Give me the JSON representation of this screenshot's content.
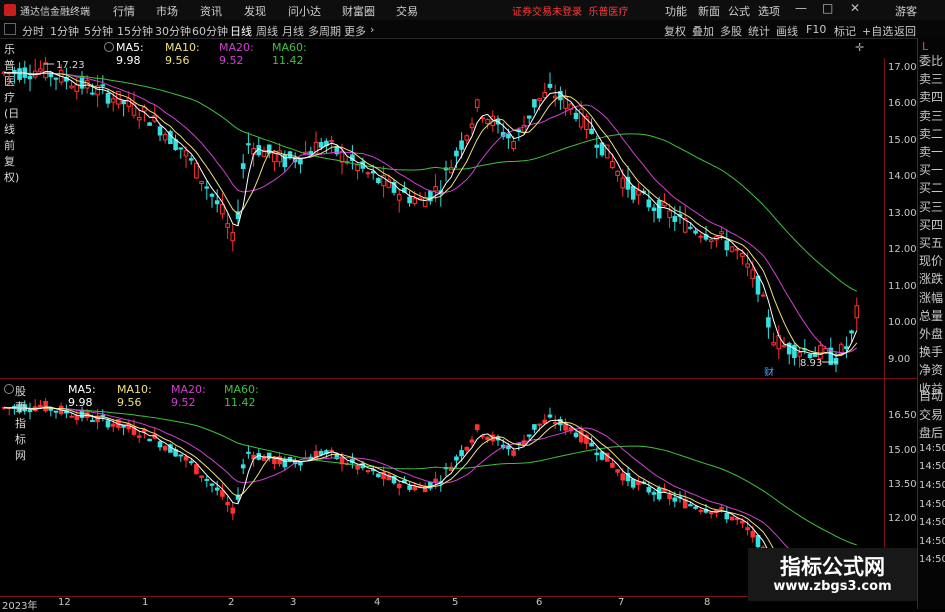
{
  "colors": {
    "up": "#ff3030",
    "down": "#35e0e0",
    "ma5": "#ffffff",
    "ma10": "#f0e080",
    "ma20": "#d040d0",
    "ma60": "#40c040",
    "accent": "#ff3b3b"
  },
  "titlebar": {
    "app_name": "通达信金融终端",
    "menu": [
      "行情",
      "市场",
      "资讯",
      "发现",
      "问小达",
      "财富圈",
      "交易"
    ],
    "status_text": "证券交易未登录",
    "stock_name": "乐普医疗",
    "right_menu": [
      "功能",
      "新面",
      "公式",
      "选项"
    ],
    "guest": "游客",
    "window_controls": [
      "—",
      "□",
      "✕"
    ]
  },
  "periods": [
    "分时",
    "1分钟",
    "5分钟",
    "15分钟",
    "30分钟",
    "60分钟",
    "日线",
    "周线",
    "月线",
    "多周期",
    "更多"
  ],
  "period_active": "日线",
  "toolbar": [
    "复权",
    "叠加",
    "多股",
    "统计",
    "画线",
    "F10",
    "标记",
    "+自选",
    "返回"
  ],
  "upper": {
    "title": "乐普医疗(日线 前复权)",
    "ma5": "MA5: 9.98",
    "ma10": "MA10: 9.56",
    "ma20": "MA20: 9.52",
    "ma60": "MA60: 11.42",
    "high_label": "17.23",
    "low_label": "8.93",
    "cai_label": "财",
    "price_labels": [
      "17.00",
      "16.00",
      "15.00",
      "14.00",
      "13.00",
      "12.00",
      "11.00",
      "10.00",
      "9.00"
    ]
  },
  "lower": {
    "title": "股票指标网",
    "ma5": "MA5: 9.98",
    "ma10": "MA10: 9.56",
    "ma20": "MA20: 9.52",
    "ma60": "MA60: 11.42",
    "price_labels": [
      "16.50",
      "15.00",
      "13.50",
      "12.00"
    ]
  },
  "side": {
    "letter": "L",
    "items": [
      "委比",
      "卖三",
      "卖四",
      "卖三",
      "卖二",
      "卖一",
      "买一",
      "买二",
      "买三",
      "买四",
      "买五",
      "现价",
      "涨跌",
      "涨幅",
      "总量",
      "外盘",
      "换手",
      "净资",
      "收益"
    ],
    "items_lower": [
      "自动",
      "交易",
      "盘后",
      "14:50",
      "14:50",
      "14:50",
      "14:50",
      "14:50",
      "14:50",
      "14:50"
    ]
  },
  "date_axis": [
    "2023年",
    "12",
    "1",
    "2",
    "3",
    "4",
    "5",
    "6",
    "7",
    "8"
  ],
  "watermark": {
    "title": "指标公式网",
    "url": "www.zbgs3.com"
  }
}
